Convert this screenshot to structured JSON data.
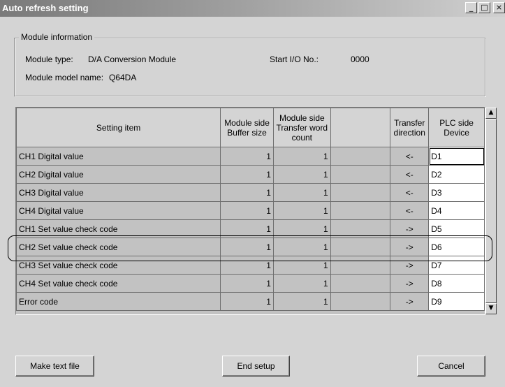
{
  "window": {
    "title": "Auto refresh setting",
    "controls": {
      "minimize": "_",
      "maximize": "□",
      "close": "×"
    }
  },
  "module_info": {
    "legend": "Module information",
    "type_label": "Module type:",
    "type_value": "D/A Conversion Module",
    "start_io_label": "Start I/O No.:",
    "start_io_value": "0000",
    "model_label": "Module model name:",
    "model_value": "Q64DA"
  },
  "table": {
    "headers": {
      "setting_item": "Setting item",
      "buffer_size": "Module side Buffer size",
      "transfer_count": "Module side Transfer word count",
      "blank": "",
      "direction": "Transfer direction",
      "plc_device": "PLC side Device"
    },
    "rows": [
      {
        "item": "CH1 Digital value",
        "buffer": "1",
        "count": "1",
        "dir": "<-",
        "device": "D1"
      },
      {
        "item": "CH2 Digital value",
        "buffer": "1",
        "count": "1",
        "dir": "<-",
        "device": "D2"
      },
      {
        "item": "CH3 Digital value",
        "buffer": "1",
        "count": "1",
        "dir": "<-",
        "device": "D3"
      },
      {
        "item": "CH4 Digital value",
        "buffer": "1",
        "count": "1",
        "dir": "<-",
        "device": "D4"
      },
      {
        "item": "CH1 Set value check code",
        "buffer": "1",
        "count": "1",
        "dir": "->",
        "device": "D5"
      },
      {
        "item": "CH2 Set value check code",
        "buffer": "1",
        "count": "1",
        "dir": "->",
        "device": "D6"
      },
      {
        "item": "CH3 Set value check code",
        "buffer": "1",
        "count": "1",
        "dir": "->",
        "device": "D7"
      },
      {
        "item": "CH4 Set value check code",
        "buffer": "1",
        "count": "1",
        "dir": "->",
        "device": "D8"
      },
      {
        "item": "Error code",
        "buffer": "1",
        "count": "1",
        "dir": "->",
        "device": "D9"
      }
    ]
  },
  "scrollbar": {
    "up": "▲",
    "down": "▼"
  },
  "buttons": {
    "make_text_file": "Make text file",
    "end_setup": "End setup",
    "cancel": "Cancel"
  }
}
